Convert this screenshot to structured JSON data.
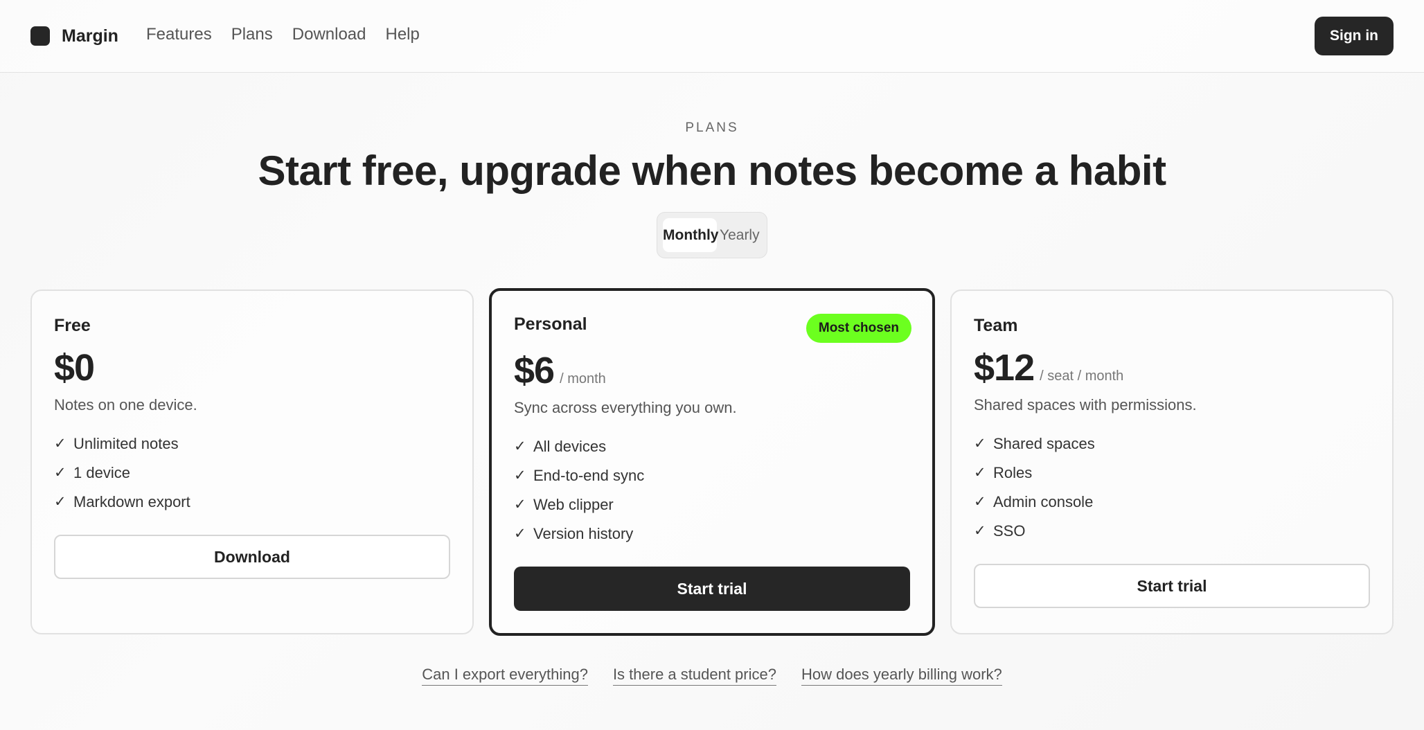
{
  "nav": {
    "brand": "Margin",
    "links": [
      "Features",
      "Plans",
      "Download",
      "Help"
    ],
    "sign_in": "Sign in"
  },
  "hero": {
    "eyebrow": "PLANS",
    "headline": "Start free, upgrade when notes become a habit"
  },
  "billing_toggle": {
    "options": [
      "Monthly",
      "Yearly"
    ],
    "selected": "Monthly"
  },
  "plans": [
    {
      "name": "Free",
      "price": "$0",
      "period": "",
      "description": "Notes on one device.",
      "features": [
        "Unlimited notes",
        "1 device",
        "Markdown export"
      ],
      "cta": "Download"
    },
    {
      "name": "Personal",
      "badge": "Most chosen",
      "price": "$6",
      "period": "/ month",
      "description": "Sync across everything you own.",
      "features": [
        "All devices",
        "End-to-end sync",
        "Web clipper",
        "Version history"
      ],
      "cta": "Start trial"
    },
    {
      "name": "Team",
      "price": "$12",
      "period": "/ seat / month",
      "description": "Shared spaces with permissions.",
      "features": [
        "Shared spaces",
        "Roles",
        "Admin console",
        "SSO"
      ],
      "cta": "Start trial"
    }
  ],
  "faq": [
    "Can I export everything?",
    "Is there a student price?",
    "How does yearly billing work?"
  ],
  "check_glyph": "✓",
  "colors": {
    "badge": "#6cff1f",
    "primary": "#262626"
  }
}
